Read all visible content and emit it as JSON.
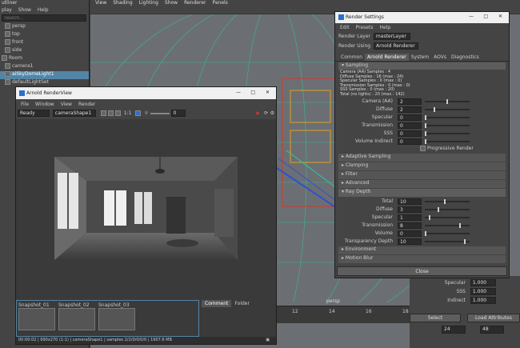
{
  "outliner": {
    "title": "utliner",
    "menu": [
      "play",
      "Show",
      "Help"
    ],
    "search_placeholder": "Search...",
    "items": [
      "persp",
      "top",
      "front",
      "side",
      "Room",
      "camera1",
      "aiSkyDomeLight1",
      "defaultLightSet"
    ]
  },
  "viewport": {
    "menu": [
      "View",
      "Shading",
      "Lighting",
      "Show",
      "Renderer",
      "Panels"
    ],
    "camera_label": "persp",
    "timeline_ticks": [
      "12",
      "14",
      "16",
      "18",
      "20",
      "22",
      "24"
    ]
  },
  "renderview": {
    "title": "Arnold RenderView",
    "menu": [
      "File",
      "Window",
      "View",
      "Render"
    ],
    "status_select": "Ready",
    "camera_select": "cameraShape1",
    "ratio": "1:1",
    "exposure": "0",
    "snapshots": [
      "Snapshot_01",
      "Snapshot_02",
      "Snapshot_03"
    ],
    "tabs": [
      "Comment",
      "Folder"
    ],
    "status_bar": "00:00:02 | 690x270 (1:1) | cameraShape1 | samples 2/2/0/0/0/0 | 1907.6 MB"
  },
  "render_settings": {
    "title": "Render Settings",
    "menu": [
      "Edit",
      "Presets",
      "Help"
    ],
    "render_layer_label": "Render Layer",
    "render_layer_value": "masterLayer",
    "render_using_label": "Render Using",
    "render_using_value": "Arnold Renderer",
    "tabs": [
      "Common",
      "Arnold Renderer",
      "System",
      "AOVs",
      "Diagnostics"
    ],
    "sampling_title": "Sampling",
    "sample_info": [
      "Camera (AA) Samples : 4",
      "Diffuse Samples : 16 (max : 24)",
      "Specular Samples : 0 (max : 0)",
      "Transmission Samples : 0 (max : 0)",
      "SSS Samples : 0 (max : 20)",
      "Total (no lights) : 20 (max : 142)"
    ],
    "sampling_rows": [
      {
        "label": "Camera (AA)",
        "value": "2",
        "level": 0.5
      },
      {
        "label": "Diffuse",
        "value": "2",
        "level": 0.2
      },
      {
        "label": "Specular",
        "value": "0",
        "level": 0
      },
      {
        "label": "Transmission",
        "value": "0",
        "level": 0
      },
      {
        "label": "SSS",
        "value": "0",
        "level": 0
      },
      {
        "label": "Volume Indirect",
        "value": "0",
        "level": 0
      }
    ],
    "progressive_label": "Progressive Render",
    "collapsed_sections": [
      "Adaptive Sampling",
      "Clamping",
      "Filter",
      "Advanced"
    ],
    "ray_depth_title": "Ray Depth",
    "ray_rows": [
      {
        "label": "Total",
        "value": "10",
        "level": 0.45
      },
      {
        "label": "Diffuse",
        "value": "3",
        "level": 0.3
      },
      {
        "label": "Specular",
        "value": "1",
        "level": 0.1
      },
      {
        "label": "Transmission",
        "value": "8",
        "level": 0.8
      },
      {
        "label": "Volume",
        "value": "0",
        "level": 0
      },
      {
        "label": "Transparency Depth",
        "value": "10",
        "level": 0.9
      }
    ],
    "bottom_sections": [
      "Environment",
      "Motion Blur"
    ],
    "close_label": "Close"
  },
  "attribute_editor": {
    "rows": [
      {
        "label": "Specular",
        "value": "1.000"
      },
      {
        "label": "SSS",
        "value": "1.000"
      },
      {
        "label": "Indirect",
        "value": "1.000"
      }
    ],
    "select_label": "Select",
    "load_label": "Load Attributes",
    "frame_start": "24",
    "frame_end": "48"
  }
}
